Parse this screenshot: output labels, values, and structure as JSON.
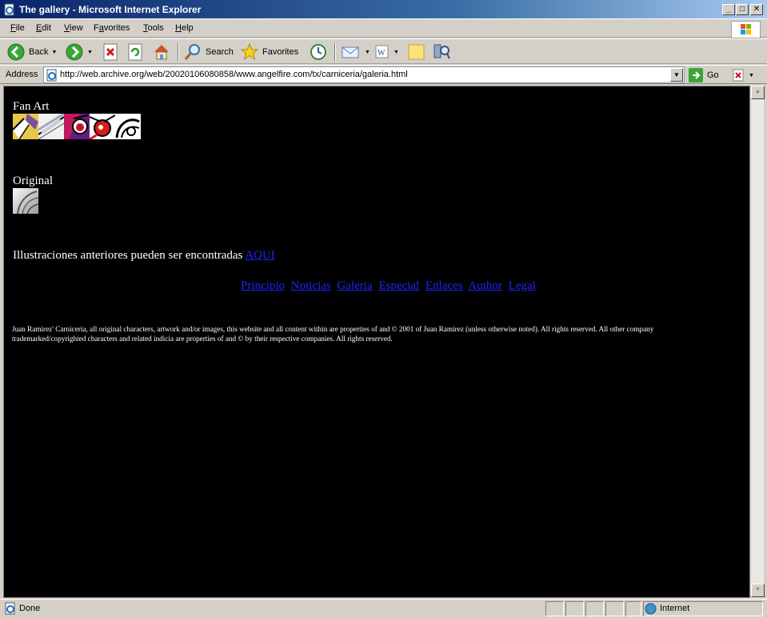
{
  "window": {
    "title": "The gallery - Microsoft Internet Explorer",
    "minimize": "_",
    "maximize": "□",
    "close": "✕"
  },
  "menu": [
    "File",
    "Edit",
    "View",
    "Favorites",
    "Tools",
    "Help"
  ],
  "menu_keys": [
    "F",
    "E",
    "V",
    "a",
    "T",
    "H"
  ],
  "toolbar": {
    "back_label": "Back",
    "search_label": "Search",
    "favorites_label": "Favorites"
  },
  "address": {
    "label": "Address",
    "url": "http://web.archive.org/web/20020106080858/www.angelfire.com/tx/carniceria/galeria.html",
    "go_label": "Go"
  },
  "page": {
    "fan_art_label": "Fan Art",
    "original_label": "Original",
    "earlier_text": "Illustraciones anteriores pueden ser encontradas ",
    "earlier_link": "AQUI",
    "nav": [
      "Principio",
      "Noticias",
      "Galeria",
      "Especial",
      "Enlaces",
      "Author",
      "Legal"
    ],
    "footer": "Juan Ramirez' Carniceria, all original characters, artwork and/or images, this website and all content within are properties of and © 2001 of Juan Ramirez (unless otherwise noted). All rights reserved. All other company trademarked/copyrighted characters and related indicia are properties of and © by their respective companies. All rights reserved."
  },
  "status": {
    "text": "Done",
    "zone": "Internet"
  },
  "colors": {
    "page_bg": "#000000",
    "page_text": "#ffffff",
    "link": "#2222ff",
    "title_bar": "#0a246a"
  },
  "icons": [
    "ie-page-icon",
    "back-icon",
    "forward-icon",
    "stop-icon",
    "refresh-icon",
    "home-icon",
    "search-icon",
    "favorites-star-icon",
    "history-icon",
    "mail-icon",
    "edit-word-icon",
    "notes-icon",
    "research-icon",
    "go-arrow-icon",
    "globe-icon"
  ]
}
